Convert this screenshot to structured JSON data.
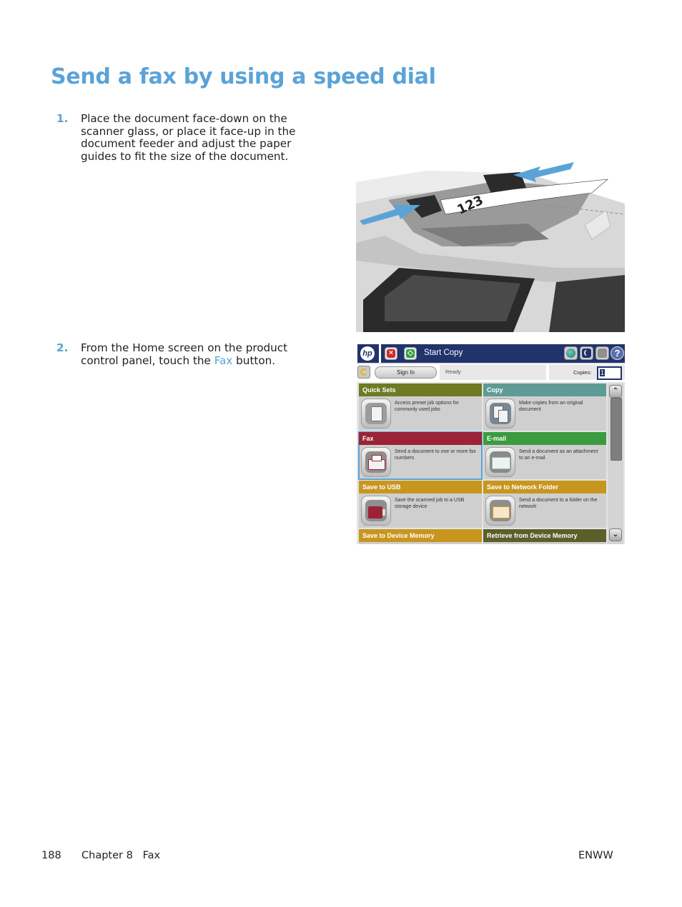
{
  "page": {
    "title": "Send a fax by using a speed dial",
    "accent_color": "#5ba3d7"
  },
  "steps": [
    {
      "number": "1.",
      "text": "Place the document face-down on the scanner glass, or place it face-up in the document feeder and adjust the paper guides to fit the size of the document."
    },
    {
      "number": "2.",
      "text_before": "From the Home screen on the product control panel, touch the ",
      "link": "Fax",
      "text_after": " button."
    }
  ],
  "illustration": {
    "description": "Document feeder with paper guides and arrows",
    "paper_label": "123"
  },
  "control_panel": {
    "logo": "hp",
    "start_label": "Start Copy",
    "icons": {
      "stop": "stop-icon",
      "start": "start-icon",
      "language": "globe-icon",
      "sleep": "sleep-moon-icon",
      "network": "network-icon",
      "help": "help-icon"
    },
    "sign_in_label": "Sign In",
    "status": "Ready",
    "copies_label": "Copies:",
    "copies_value": "1",
    "tiles": [
      {
        "id": "quick-sets",
        "label": "Quick Sets",
        "description": "Access preset job options for commonly used jobs",
        "color": "#6e7a24"
      },
      {
        "id": "copy",
        "label": "Copy",
        "description": "Make copies from an original document",
        "color": "#5f9b96"
      },
      {
        "id": "fax",
        "label": "Fax",
        "description": "Send a document to one or more fax numbers",
        "color": "#9b2335",
        "selected": true
      },
      {
        "id": "email",
        "label": "E-mail",
        "description": "Send a document as an attachment to an e-mail",
        "color": "#3a9c3f"
      },
      {
        "id": "save-usb",
        "label": "Save to USB",
        "description": "Save the scanned job to a USB storage device",
        "color": "#c8961f"
      },
      {
        "id": "save-network-folder",
        "label": "Save to Network Folder",
        "description": "Send a document to a folder on the network",
        "color": "#c8961f"
      },
      {
        "id": "save-device-memory",
        "label": "Save to Device Memory",
        "description": "",
        "color": "#c8961f"
      },
      {
        "id": "retrieve-device-memory",
        "label": "Retrieve from Device Memory",
        "description": "",
        "color": "#5c5f2a"
      }
    ]
  },
  "footer": {
    "page_number": "188",
    "chapter": "Chapter 8   Fax",
    "code": "ENWW"
  }
}
